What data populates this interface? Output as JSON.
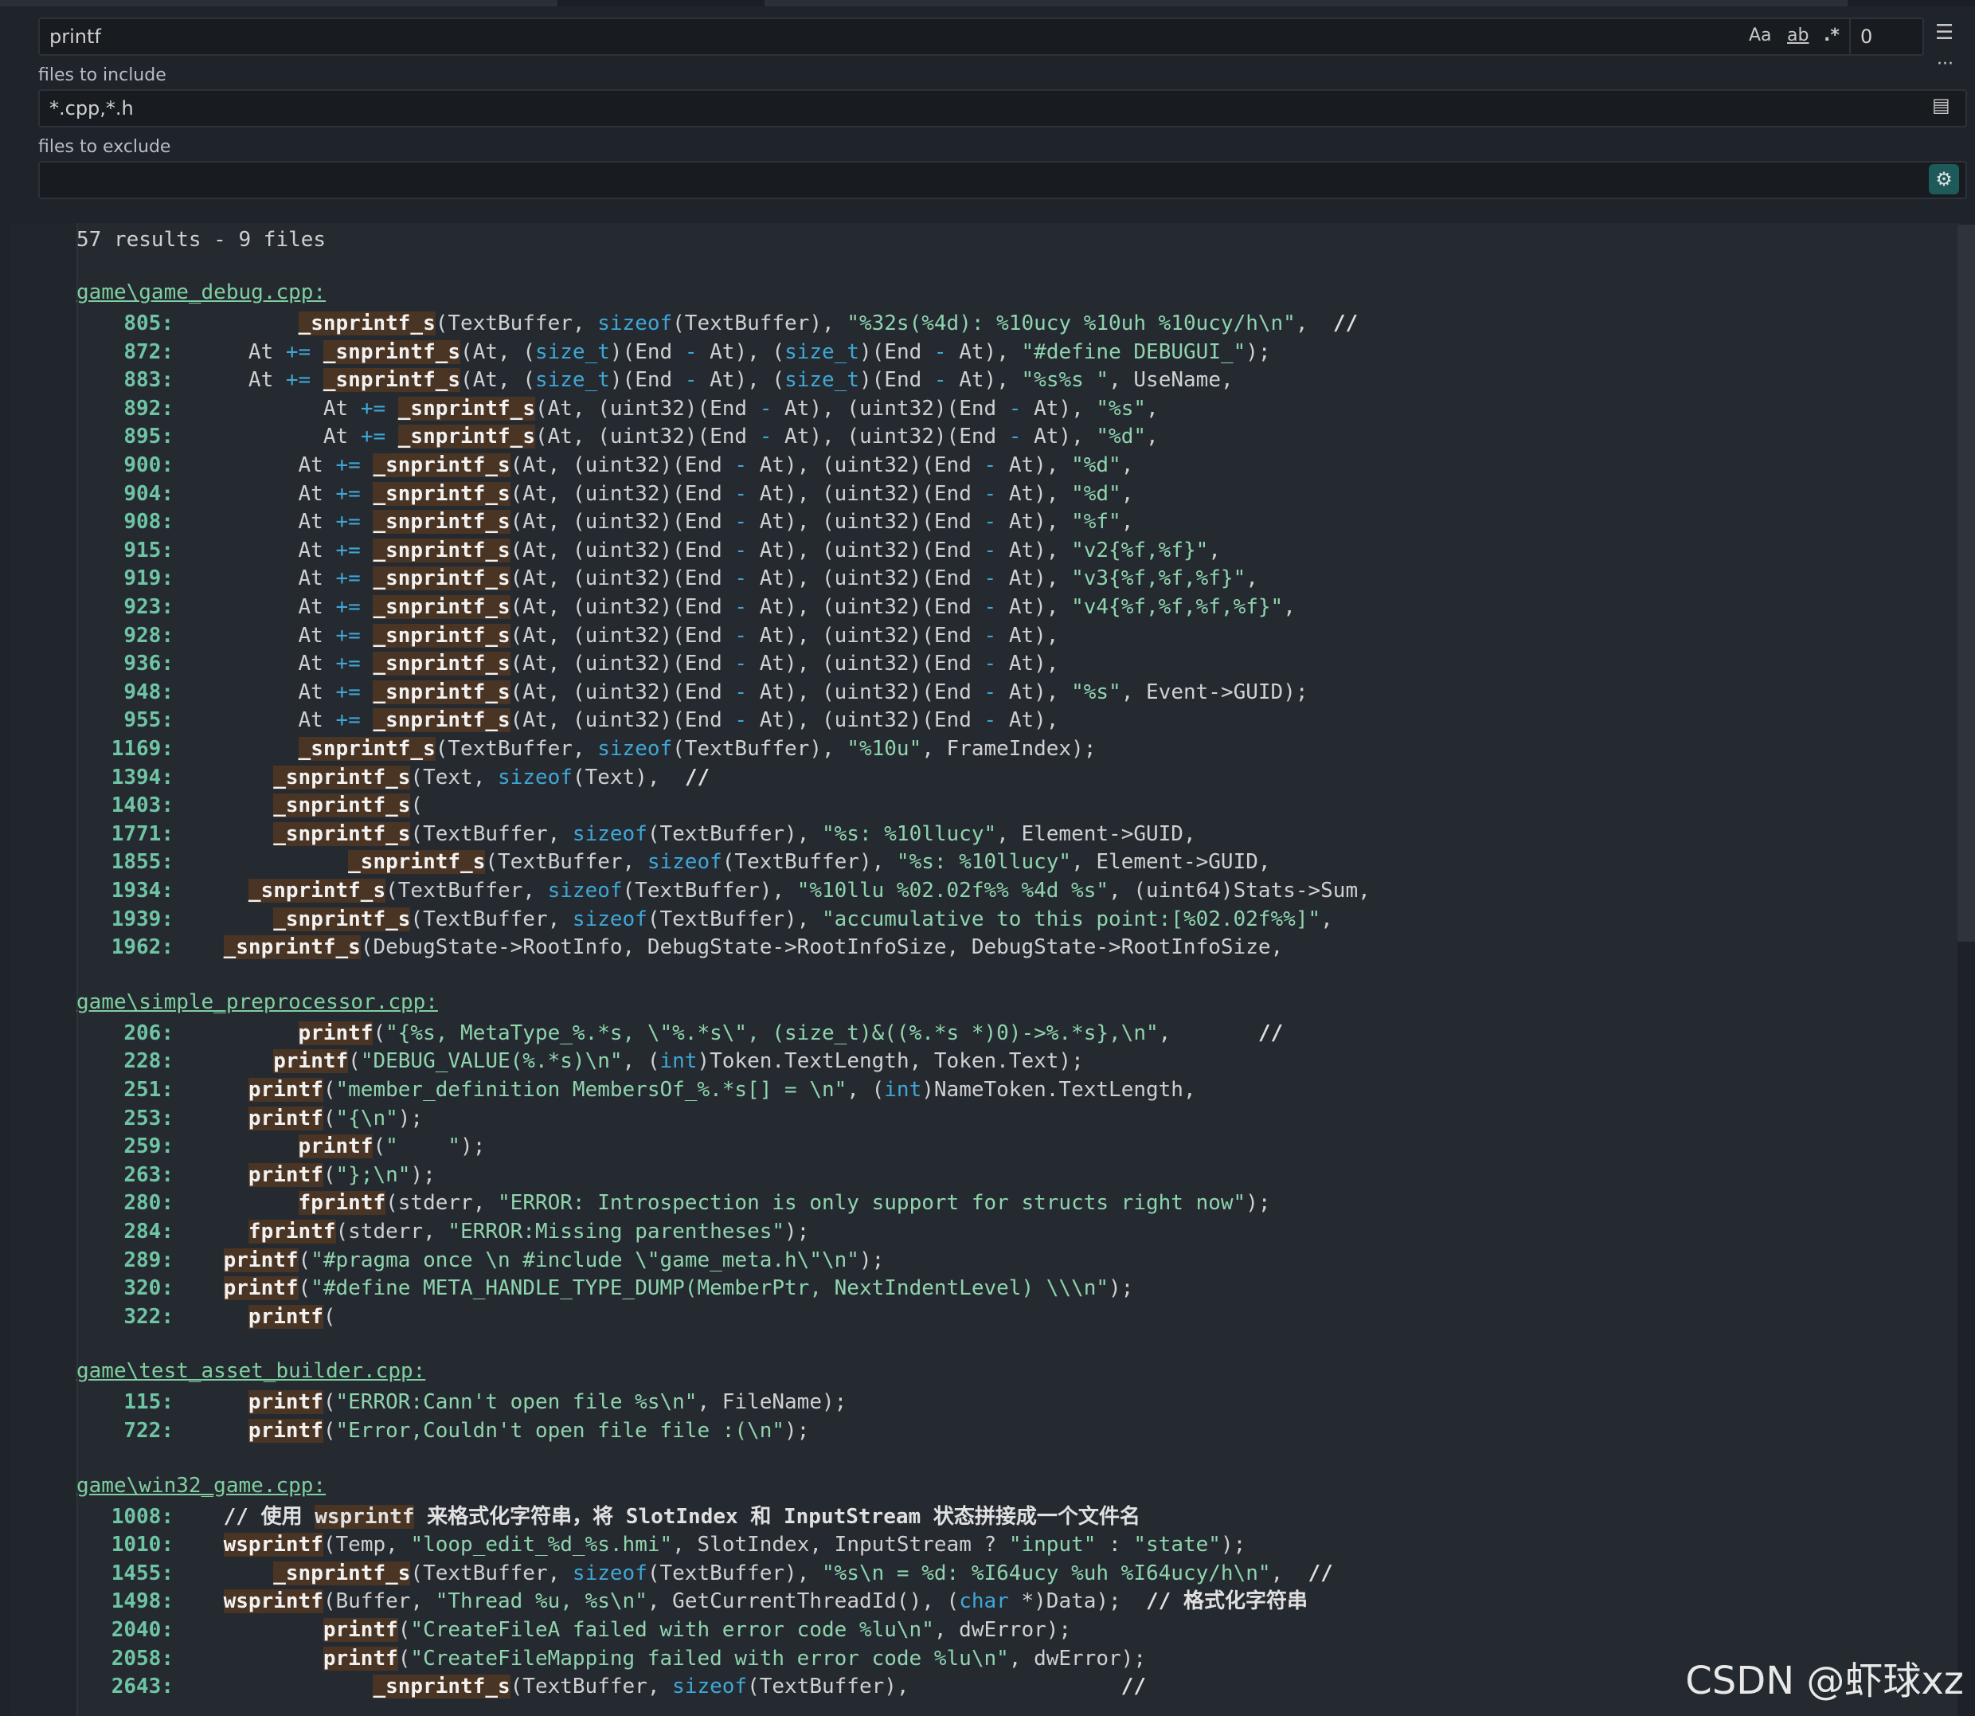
{
  "search": {
    "query": "printf",
    "options": {
      "match_case": "Aa",
      "whole_word": "ab",
      "regex": ".*"
    },
    "replace_value": "0",
    "include_label": "files to include",
    "include_value": "*.cpp,*.h",
    "exclude_label": "files to exclude",
    "exclude_value": ""
  },
  "summary": "57 results - 9 files",
  "groups": [
    {
      "file": "game\\game_debug.cpp:",
      "rows": [
        {
          "n": "805:",
          "c": "        _snprintf_s(TextBuffer, sizeof(TextBuffer), \"%32s(%4d): %10ucy %10uh %10ucy/h\\n\",  //"
        },
        {
          "n": "872:",
          "c": "    At += _snprintf_s(At, (size_t)(End - At), (size_t)(End - At), \"#define DEBUGUI_\");"
        },
        {
          "n": "883:",
          "c": "    At += _snprintf_s(At, (size_t)(End - At), (size_t)(End - At), \"%s%s \", UseName,"
        },
        {
          "n": "892:",
          "c": "          At += _snprintf_s(At, (uint32)(End - At), (uint32)(End - At), \"%s\","
        },
        {
          "n": "895:",
          "c": "          At += _snprintf_s(At, (uint32)(End - At), (uint32)(End - At), \"%d\","
        },
        {
          "n": "900:",
          "c": "        At += _snprintf_s(At, (uint32)(End - At), (uint32)(End - At), \"%d\","
        },
        {
          "n": "904:",
          "c": "        At += _snprintf_s(At, (uint32)(End - At), (uint32)(End - At), \"%d\","
        },
        {
          "n": "908:",
          "c": "        At += _snprintf_s(At, (uint32)(End - At), (uint32)(End - At), \"%f\","
        },
        {
          "n": "915:",
          "c": "        At += _snprintf_s(At, (uint32)(End - At), (uint32)(End - At), \"v2{%f,%f}\","
        },
        {
          "n": "919:",
          "c": "        At += _snprintf_s(At, (uint32)(End - At), (uint32)(End - At), \"v3{%f,%f,%f}\","
        },
        {
          "n": "923:",
          "c": "        At += _snprintf_s(At, (uint32)(End - At), (uint32)(End - At), \"v4{%f,%f,%f,%f}\","
        },
        {
          "n": "928:",
          "c": "        At += _snprintf_s(At, (uint32)(End - At), (uint32)(End - At),"
        },
        {
          "n": "936:",
          "c": "        At += _snprintf_s(At, (uint32)(End - At), (uint32)(End - At),"
        },
        {
          "n": "948:",
          "c": "        At += _snprintf_s(At, (uint32)(End - At), (uint32)(End - At), \"%s\", Event->GUID);"
        },
        {
          "n": "955:",
          "c": "        At += _snprintf_s(At, (uint32)(End - At), (uint32)(End - At),"
        },
        {
          "n": "1169:",
          "c": "        _snprintf_s(TextBuffer, sizeof(TextBuffer), \"%10u\", FrameIndex);"
        },
        {
          "n": "1394:",
          "c": "      _snprintf_s(Text, sizeof(Text),  //"
        },
        {
          "n": "1403:",
          "c": "      _snprintf_s("
        },
        {
          "n": "1771:",
          "c": "      _snprintf_s(TextBuffer, sizeof(TextBuffer), \"%s: %10llucy\", Element->GUID,"
        },
        {
          "n": "1855:",
          "c": "            _snprintf_s(TextBuffer, sizeof(TextBuffer), \"%s: %10llucy\", Element->GUID,"
        },
        {
          "n": "1934:",
          "c": "    _snprintf_s(TextBuffer, sizeof(TextBuffer), \"%10llu %02.02f%% %4d %s\", (uint64)Stats->Sum,"
        },
        {
          "n": "1939:",
          "c": "      _snprintf_s(TextBuffer, sizeof(TextBuffer), \"accumulative to this point:[%02.02f%%]\","
        },
        {
          "n": "1962:",
          "c": "  _snprintf_s(DebugState->RootInfo, DebugState->RootInfoSize, DebugState->RootInfoSize,"
        }
      ]
    },
    {
      "file": "game\\simple_preprocessor.cpp:",
      "rows": [
        {
          "n": "206:",
          "c": "        printf(\"{%s, MetaType_%.*s, \\\"%.*s\\\", (size_t)&((%.*s *)0)->%.*s},\\n\",       //"
        },
        {
          "n": "228:",
          "c": "      printf(\"DEBUG_VALUE(%.*s)\\n\", (int)Token.TextLength, Token.Text);"
        },
        {
          "n": "251:",
          "c": "    printf(\"member_definition MembersOf_%.*s[] = \\n\", (int)NameToken.TextLength,"
        },
        {
          "n": "253:",
          "c": "    printf(\"{\\n\");"
        },
        {
          "n": "259:",
          "c": "        printf(\"    \");"
        },
        {
          "n": "263:",
          "c": "    printf(\"};\\n\");"
        },
        {
          "n": "280:",
          "c": "        fprintf(stderr, \"ERROR: Introspection is only support for structs right now\");"
        },
        {
          "n": "284:",
          "c": "    fprintf(stderr, \"ERROR:Missing parentheses\");"
        },
        {
          "n": "289:",
          "c": "  printf(\"#pragma once \\n #include \\\"game_meta.h\\\"\\n\");"
        },
        {
          "n": "320:",
          "c": "  printf(\"#define META_HANDLE_TYPE_DUMP(MemberPtr, NextIndentLevel) \\\\\\n\");"
        },
        {
          "n": "322:",
          "c": "    printf("
        }
      ]
    },
    {
      "file": "game\\test_asset_builder.cpp:",
      "rows": [
        {
          "n": "115:",
          "c": "    printf(\"ERROR:Cann't open file %s\\n\", FileName);"
        },
        {
          "n": "722:",
          "c": "    printf(\"Error,Couldn't open file file :(\\n\");"
        }
      ]
    },
    {
      "file": "game\\win32_game.cpp:",
      "rows": [
        {
          "n": "1008:",
          "c": "  // 使用 wsprintf 来格式化字符串，将 SlotIndex 和 InputStream 状态拼接成一个文件名"
        },
        {
          "n": "1010:",
          "c": "  wsprintf(Temp, \"loop_edit_%d_%s.hmi\", SlotIndex, InputStream ? \"input\" : \"state\");"
        },
        {
          "n": "1455:",
          "c": "      _snprintf_s(TextBuffer, sizeof(TextBuffer), \"%s\\n = %d: %I64ucy %uh %I64ucy/h\\n\",  //"
        },
        {
          "n": "1498:",
          "c": "  wsprintf(Buffer, \"Thread %u, %s\\n\", GetCurrentThreadId(), (char *)Data);  // 格式化字符串"
        },
        {
          "n": "2040:",
          "c": "          printf(\"CreateFileA failed with error code %lu\\n\", dwError);"
        },
        {
          "n": "2058:",
          "c": "          printf(\"CreateFileMapping failed with error code %lu\\n\", dwError);"
        },
        {
          "n": "2643:",
          "c": "              _snprintf_s(TextBuffer, sizeof(TextBuffer),                 //"
        }
      ]
    }
  ],
  "watermark": "CSDN @虾球xz",
  "colors": {
    "match_bg": "#4a3424",
    "line_number": "#6fc4a3",
    "string": "#8fd4ad",
    "keyword": "#3fa7d6",
    "path": "#7fcfa0"
  }
}
